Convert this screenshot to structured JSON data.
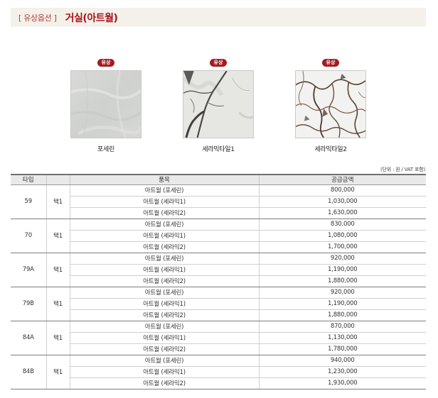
{
  "header": {
    "category": "[ 유상옵션 ]",
    "title": "거실(아트월)"
  },
  "swatches": [
    {
      "badge": "유상",
      "name": "포세린",
      "texture": "porcelain"
    },
    {
      "badge": "유상",
      "name": "세라믹타일1",
      "texture": "ceramic1"
    },
    {
      "badge": "유상",
      "name": "세라믹타일2",
      "texture": "ceramic2"
    }
  ],
  "unit_note": "(단위 : 원 / VAT 포함)",
  "table": {
    "headers": [
      "타입",
      "",
      "품목",
      "공급금액"
    ],
    "groups": [
      {
        "type": "59",
        "package": "택1",
        "rows": [
          {
            "item": "아트월 (포세린)",
            "price": "800,000"
          },
          {
            "item": "아트월 (세라믹1)",
            "price": "1,030,000"
          },
          {
            "item": "아트월 (세라믹2)",
            "price": "1,630,000"
          }
        ]
      },
      {
        "type": "70",
        "package": "택1",
        "rows": [
          {
            "item": "아트월 (포세린)",
            "price": "830,000"
          },
          {
            "item": "아트월 (세라믹1)",
            "price": "1,080,000"
          },
          {
            "item": "아트월 (세라믹2)",
            "price": "1,700,000"
          }
        ]
      },
      {
        "type": "79A",
        "package": "택1",
        "rows": [
          {
            "item": "아트월 (포세린)",
            "price": "920,000"
          },
          {
            "item": "아트월 (세라믹1)",
            "price": "1,190,000"
          },
          {
            "item": "아트월 (세라믹2)",
            "price": "1,880,000"
          }
        ]
      },
      {
        "type": "79B",
        "package": "택1",
        "rows": [
          {
            "item": "아트월 (포세린)",
            "price": "920,000"
          },
          {
            "item": "아트월 (세라믹1)",
            "price": "1,190,000"
          },
          {
            "item": "아트월 (세라믹2)",
            "price": "1,880,000"
          }
        ]
      },
      {
        "type": "84A",
        "package": "택1",
        "rows": [
          {
            "item": "아트월 (포세린)",
            "price": "870,000"
          },
          {
            "item": "아트월 (세라믹1)",
            "price": "1,130,000"
          },
          {
            "item": "아트월 (세라믹2)",
            "price": "1,780,000"
          }
        ]
      },
      {
        "type": "84B",
        "package": "택1",
        "rows": [
          {
            "item": "아트월 (포세린)",
            "price": "940,000"
          },
          {
            "item": "아트월 (세라믹1)",
            "price": "1,230,000"
          },
          {
            "item": "아트월 (세라믹2)",
            "price": "1,930,000"
          }
        ]
      }
    ]
  },
  "colors": {
    "accent": "#a8141c",
    "header_bg": "#f4f0ea",
    "table_header_bg": "#e9e9e9"
  }
}
